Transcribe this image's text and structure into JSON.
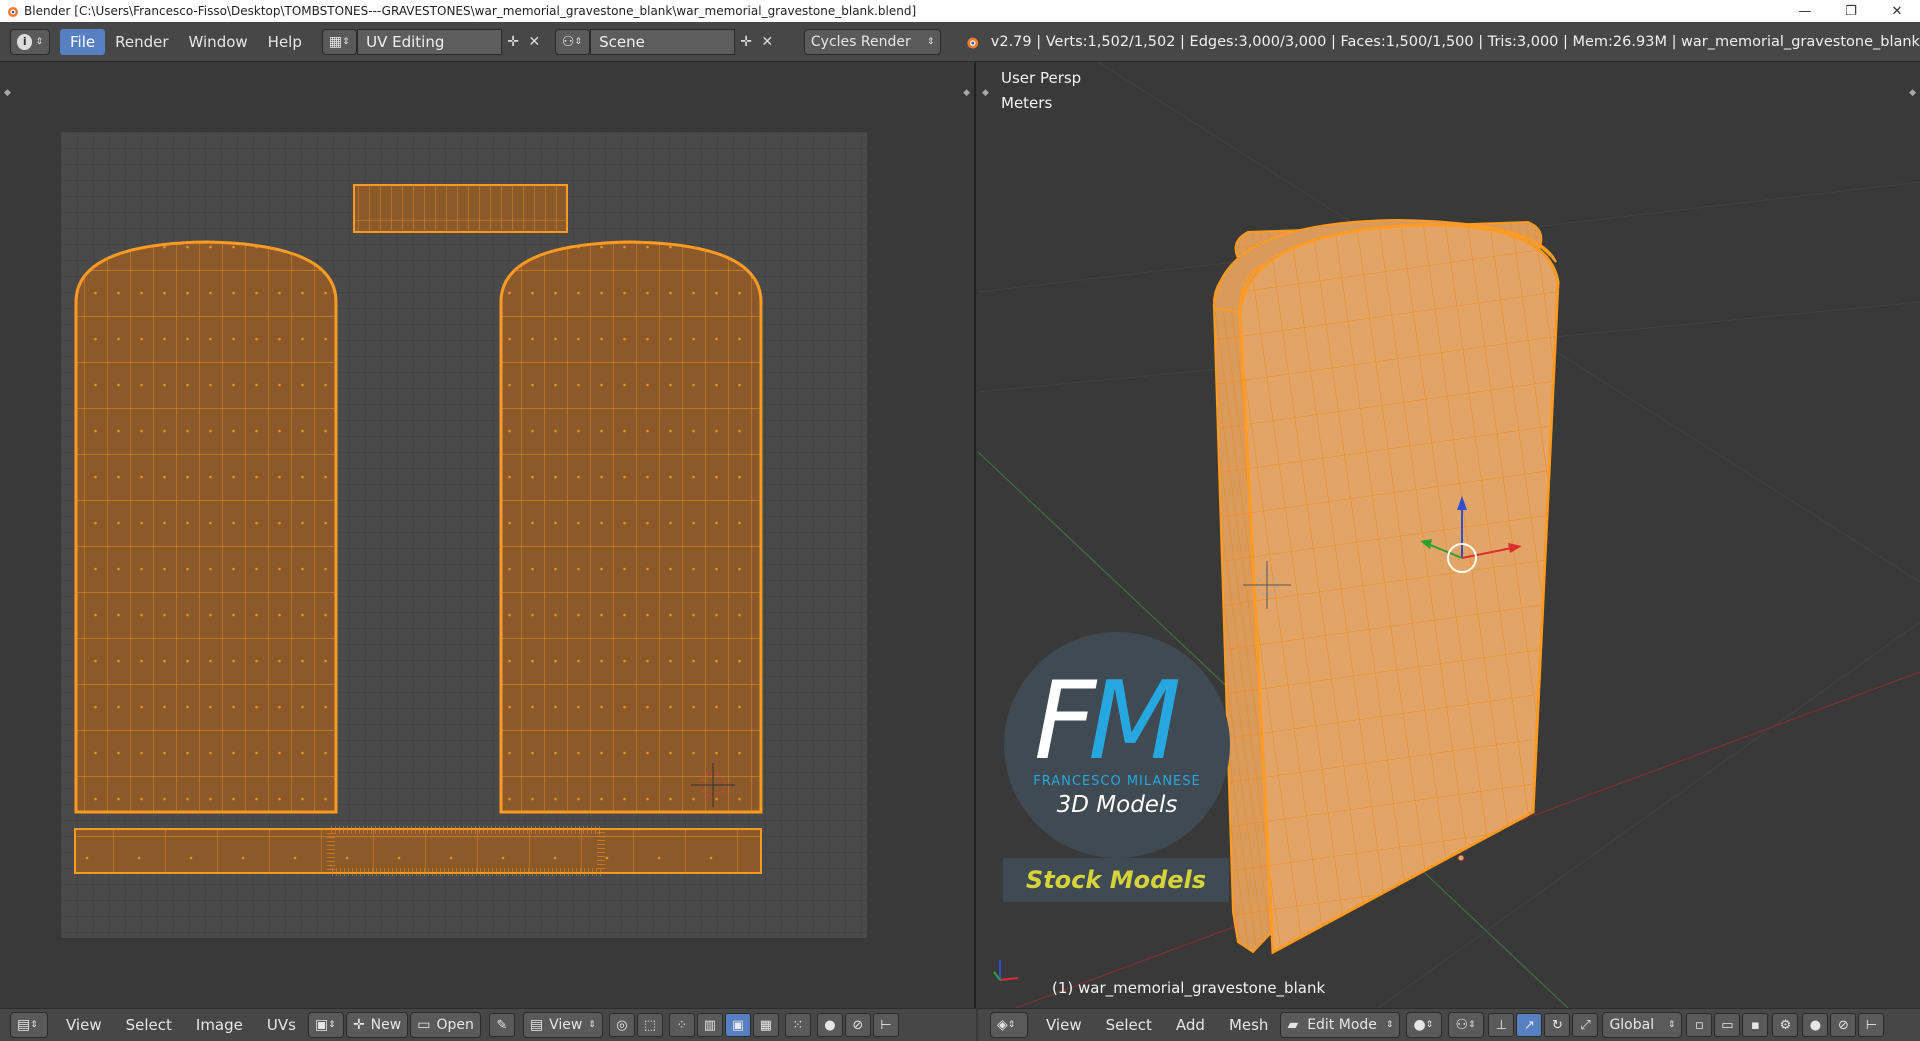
{
  "window": {
    "title": "Blender [C:\\Users\\Francesco-Fisso\\Desktop\\TOMBSTONES---GRAVESTONES\\war_memorial_gravestone_blank\\war_memorial_gravestone_blank.blend]",
    "minimize": "—",
    "maximize": "❐",
    "close": "✕"
  },
  "topbar": {
    "info_icon": "i",
    "menus": [
      "File",
      "Render",
      "Window",
      "Help"
    ],
    "screen_layout": "UV Editing",
    "scene": "Scene",
    "render_engine": "Cycles Render",
    "stats": "v2.79 | Verts:1,502/1,502 | Edges:3,000/3,000 | Faces:1,500/1,500 | Tris:3,000 | Mem:26.93M | war_memorial_gravestone_blank"
  },
  "viewport": {
    "view_name": "User Persp",
    "units": "Meters",
    "object_label": "(1) war_memorial_gravestone_blank"
  },
  "logo": {
    "letter_f": "F",
    "letter_m": "M",
    "name": "FRANCESCO MILANESE",
    "subtitle": "3D Models",
    "stock": "Stock Models"
  },
  "uv_bottom": {
    "menus": [
      "View",
      "Select",
      "Image",
      "UVs"
    ],
    "new_label": "New",
    "open_label": "Open",
    "view_label": "View"
  },
  "vp_bottom": {
    "menus": [
      "View",
      "Select",
      "Add",
      "Mesh"
    ],
    "mode": "Edit Mode",
    "orientation": "Global"
  },
  "colors": {
    "accent": "#5680c2",
    "mesh_orange": "#f0901e",
    "uv_fill": "#8c5a2a"
  }
}
